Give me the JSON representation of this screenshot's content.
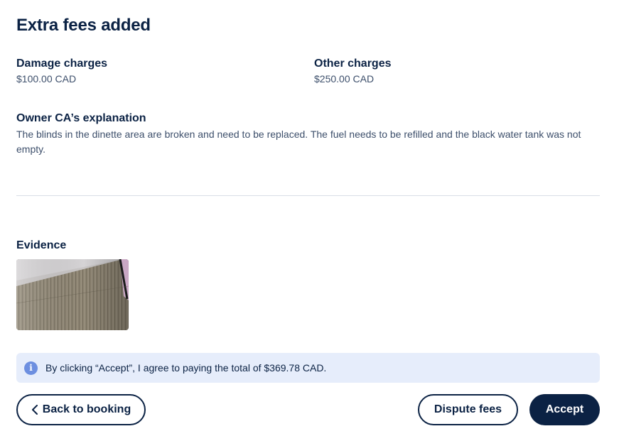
{
  "title": "Extra fees added",
  "charges": {
    "damage": {
      "label": "Damage charges",
      "amount": "$100.00 CAD"
    },
    "other": {
      "label": "Other charges",
      "amount": "$250.00 CAD"
    }
  },
  "explanation": {
    "label": "Owner CA’s explanation",
    "text": "The blinds in the dinette area are broken and need to be replaced. The fuel needs to be refilled and the black water tank was not empty."
  },
  "evidence": {
    "label": "Evidence"
  },
  "notice": {
    "icon": "info-icon",
    "text": "By clicking “Accept”, I agree to paying the total of $369.78 CAD."
  },
  "actions": {
    "back_label": "Back to booking",
    "dispute_label": "Dispute fees",
    "accept_label": "Accept"
  },
  "colors": {
    "primary": "#0b2244",
    "notice_bg": "#e6edfb",
    "info_icon": "#6d8fe0"
  }
}
